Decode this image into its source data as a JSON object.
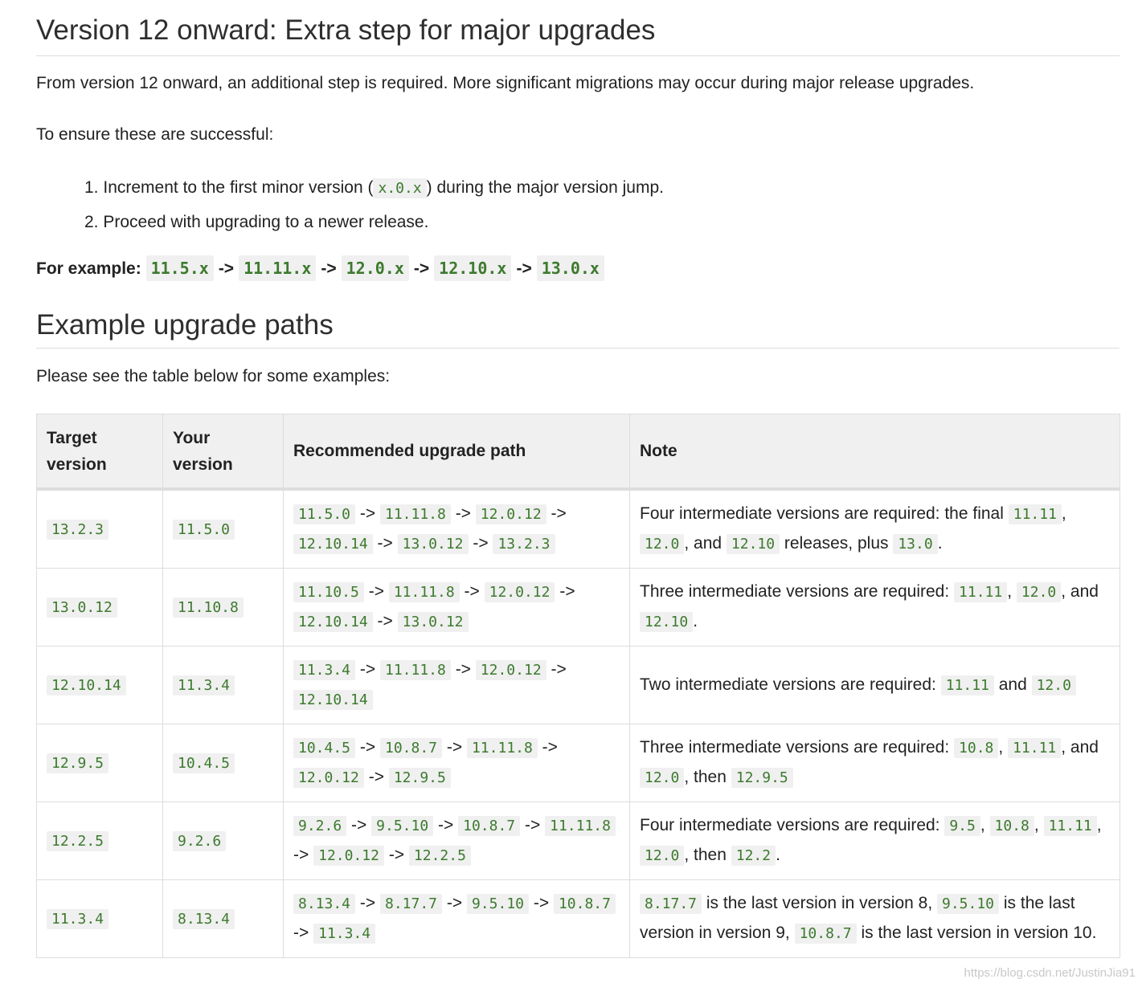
{
  "section1": {
    "heading": "Version 12 onward: Extra step for major upgrades",
    "intro": "From version 12 onward, an additional step is required. More significant migrations may occur during major release upgrades.",
    "ensure": "To ensure these are successful:",
    "steps": [
      {
        "num": "1.",
        "before": "Increment to the first minor version (",
        "code": "x.0.x",
        "after": ") during the major version jump."
      },
      {
        "num": "2.",
        "text": "Proceed with upgrading to a newer release."
      }
    ],
    "example": {
      "label": "For example:",
      "arrow": "->",
      "versions": [
        "11.5.x",
        "11.11.x",
        "12.0.x",
        "12.10.x",
        "13.0.x"
      ]
    }
  },
  "section2": {
    "heading": "Example upgrade paths",
    "intro": "Please see the table below for some examples:"
  },
  "table": {
    "headers": [
      "Target version",
      "Your version",
      "Recommended upgrade path",
      "Note"
    ],
    "arrow": "->",
    "rows": [
      {
        "target": "13.2.3",
        "yours": "11.5.0",
        "path": [
          "11.5.0",
          "11.11.8",
          "12.0.12",
          "12.10.14",
          "13.0.12",
          "13.2.3"
        ],
        "note": [
          {
            "t": "text",
            "v": "Four intermediate versions are required: the final "
          },
          {
            "t": "code",
            "v": "11.11"
          },
          {
            "t": "text",
            "v": ", "
          },
          {
            "t": "code",
            "v": "12.0"
          },
          {
            "t": "text",
            "v": ", and "
          },
          {
            "t": "code",
            "v": "12.10"
          },
          {
            "t": "text",
            "v": " releases, plus "
          },
          {
            "t": "code",
            "v": "13.0"
          },
          {
            "t": "text",
            "v": "."
          }
        ]
      },
      {
        "target": "13.0.12",
        "yours": "11.10.8",
        "path": [
          "11.10.5",
          "11.11.8",
          "12.0.12",
          "12.10.14",
          "13.0.12"
        ],
        "note": [
          {
            "t": "text",
            "v": "Three intermediate versions are required: "
          },
          {
            "t": "code",
            "v": "11.11"
          },
          {
            "t": "text",
            "v": ", "
          },
          {
            "t": "code",
            "v": "12.0"
          },
          {
            "t": "text",
            "v": ", and "
          },
          {
            "t": "code",
            "v": "12.10"
          },
          {
            "t": "text",
            "v": "."
          }
        ]
      },
      {
        "target": "12.10.14",
        "yours": "11.3.4",
        "path": [
          "11.3.4",
          "11.11.8",
          "12.0.12",
          "12.10.14"
        ],
        "note": [
          {
            "t": "text",
            "v": "Two intermediate versions are required: "
          },
          {
            "t": "code",
            "v": "11.11"
          },
          {
            "t": "text",
            "v": " and "
          },
          {
            "t": "code",
            "v": "12.0"
          }
        ]
      },
      {
        "target": "12.9.5",
        "yours": "10.4.5",
        "path": [
          "10.4.5",
          "10.8.7",
          "11.11.8",
          "12.0.12",
          "12.9.5"
        ],
        "note": [
          {
            "t": "text",
            "v": "Three intermediate versions are required: "
          },
          {
            "t": "code",
            "v": "10.8"
          },
          {
            "t": "text",
            "v": ", "
          },
          {
            "t": "code",
            "v": "11.11"
          },
          {
            "t": "text",
            "v": ", and "
          },
          {
            "t": "code",
            "v": "12.0"
          },
          {
            "t": "text",
            "v": ", then "
          },
          {
            "t": "code",
            "v": "12.9.5"
          }
        ]
      },
      {
        "target": "12.2.5",
        "yours": "9.2.6",
        "path": [
          "9.2.6",
          "9.5.10",
          "10.8.7",
          "11.11.8",
          "12.0.12",
          "12.2.5"
        ],
        "note": [
          {
            "t": "text",
            "v": "Four intermediate versions are required: "
          },
          {
            "t": "code",
            "v": "9.5"
          },
          {
            "t": "text",
            "v": ", "
          },
          {
            "t": "code",
            "v": "10.8"
          },
          {
            "t": "text",
            "v": ", "
          },
          {
            "t": "code",
            "v": "11.11"
          },
          {
            "t": "text",
            "v": ", "
          },
          {
            "t": "code",
            "v": "12.0"
          },
          {
            "t": "text",
            "v": ", then "
          },
          {
            "t": "code",
            "v": "12.2"
          },
          {
            "t": "text",
            "v": "."
          }
        ]
      },
      {
        "target": "11.3.4",
        "yours": "8.13.4",
        "path": [
          "8.13.4",
          "8.17.7",
          "9.5.10",
          "10.8.7",
          "11.3.4"
        ],
        "note": [
          {
            "t": "code",
            "v": "8.17.7"
          },
          {
            "t": "text",
            "v": " is the last version in version 8, "
          },
          {
            "t": "code",
            "v": "9.5.10"
          },
          {
            "t": "text",
            "v": " is the last version in version 9, "
          },
          {
            "t": "code",
            "v": "10.8.7"
          },
          {
            "t": "text",
            "v": " is the last version in version 10."
          }
        ]
      }
    ]
  },
  "watermark": "https://blog.csdn.net/JustinJia91"
}
